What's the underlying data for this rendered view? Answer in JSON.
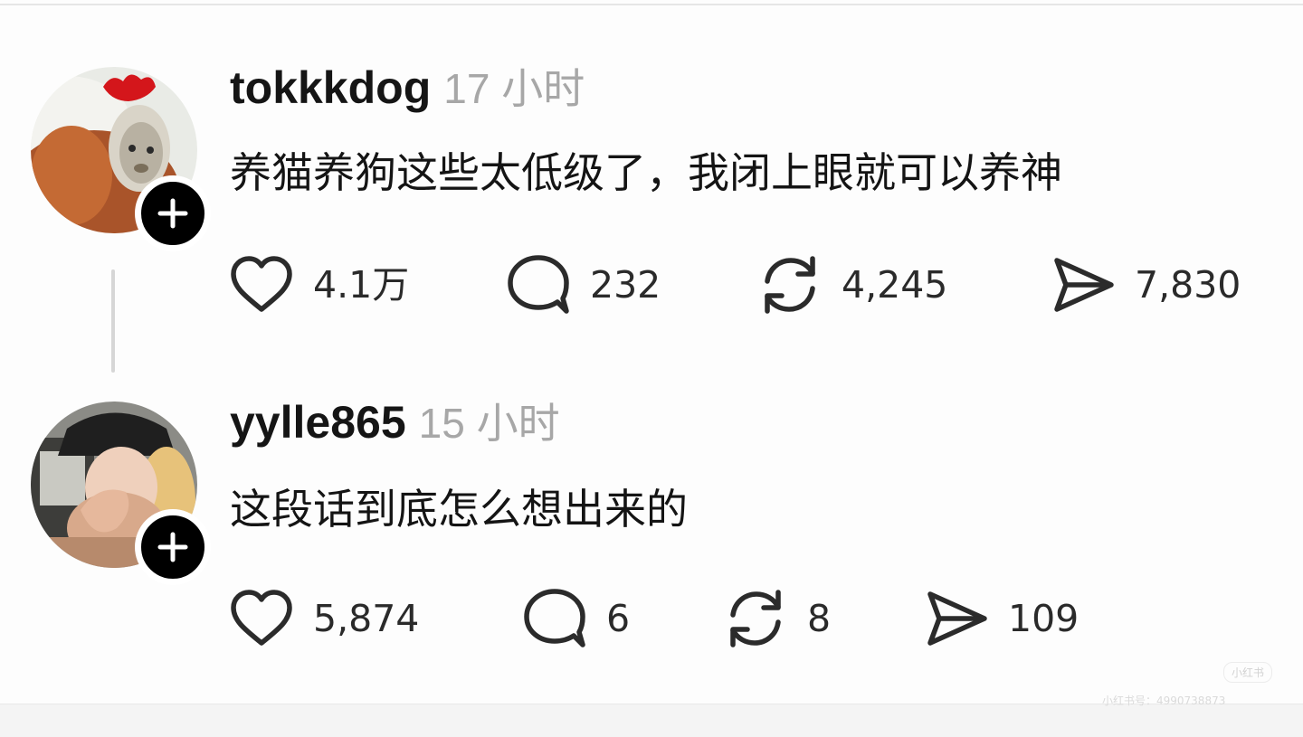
{
  "posts": [
    {
      "username": "tokkkdog",
      "timestamp": "17 小时",
      "content": "养猫养狗这些太低级了，我闭上眼就可以养神",
      "likes": "4.1万",
      "comments": "232",
      "reposts": "4,245",
      "shares": "7,830"
    },
    {
      "username": "yylle865",
      "timestamp": "15 小时",
      "content": "这段话到底怎么想出来的",
      "likes": "5,874",
      "comments": "6",
      "reposts": "8",
      "shares": "109"
    }
  ],
  "watermark": {
    "badge": "小红书",
    "text": "小红书号：4990738873"
  },
  "icons": {
    "like": "heart-icon",
    "comment": "comment-bubble-icon",
    "repost": "repost-arrows-icon",
    "share": "paper-plane-icon",
    "follow": "plus-icon"
  },
  "colors": {
    "text": "#151515",
    "timestamp": "#a7a7a7",
    "follow_button": "#000000"
  }
}
